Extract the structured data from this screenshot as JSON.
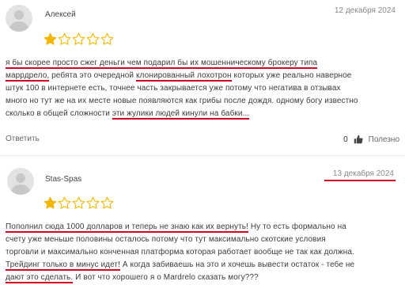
{
  "reviews": [
    {
      "author": "Алексей",
      "date": "12 декабря 2024",
      "rating": 1,
      "max_rating": 5,
      "lines": [
        [
          {
            "t": "я бы скорее просто сжег деньги чем подарил бы их мошенническому брокеру типа",
            "hl": true
          }
        ],
        [
          {
            "t": "маррдрело,",
            "hl": true
          },
          {
            "t": " ребята это очередной ",
            "hl": false
          },
          {
            "t": "клонированный лохотрон",
            "hl": true
          },
          {
            "t": " которых уже реально наверное",
            "hl": false
          }
        ],
        [
          {
            "t": "штук 100 в интернете есть, точнее часть закрывается уже потому что негатива в отзывах",
            "hl": false
          }
        ],
        [
          {
            "t": "много но тут же на их месте новые появляются как грибы после дождя. одному богу известно",
            "hl": false
          }
        ],
        [
          {
            "t": "сколько в общей сложности ",
            "hl": false
          },
          {
            "t": "эти жулики людей кинули на бабки...",
            "hl": true
          }
        ]
      ],
      "reply_label": "Ответить",
      "votes_count": "0",
      "useful_label": "Полезно"
    },
    {
      "author": "Stas-Spas",
      "date": "13 декабря 2024",
      "rating": 1,
      "max_rating": 5,
      "lines": [
        [
          {
            "t": "Пополнил сюда 1000 долларов и теперь не знаю как их вернуть!",
            "hl": true
          },
          {
            "t": " Ну то есть формально на",
            "hl": false
          }
        ],
        [
          {
            "t": "счету уже меньше половины осталось потому что тут максимально скотские условия",
            "hl": false
          }
        ],
        [
          {
            "t": "торговли и максимально конченная платформа которая работает вообще не так как должна.",
            "hl": false
          }
        ],
        [
          {
            "t": "Трейдинг только в минус идет!",
            "hl": true
          },
          {
            "t": " А когда забиваешь на это и хочешь вывести остаток - тебе не",
            "hl": false
          }
        ],
        [
          {
            "t": "дают это сделать.",
            "hl": true
          },
          {
            "t": " И вот что хорошего я о Mardrelo сказать могу???",
            "hl": false
          }
        ]
      ]
    }
  ],
  "colors": {
    "star_fill": "#f2b705",
    "star_outline": "#f2b705",
    "highlight": "#d1001f"
  }
}
